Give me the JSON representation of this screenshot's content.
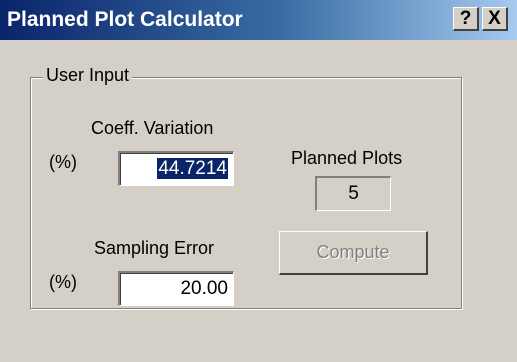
{
  "window": {
    "title": "Planned Plot Calculator",
    "help_button": "?",
    "close_button": "X"
  },
  "group": {
    "legend": "User Input"
  },
  "coeff_variation": {
    "label": "Coeff. Variation",
    "unit": "(%)",
    "value": "44.7214",
    "selected": true
  },
  "sampling_error": {
    "label": "Sampling Error",
    "unit": "(%)",
    "value": "20.00"
  },
  "planned_plots": {
    "label": "Planned Plots",
    "value": "5"
  },
  "compute": {
    "label": "Compute",
    "enabled": false
  },
  "colors": {
    "title_bar_start": "#0a246a",
    "title_bar_end": "#a6caf0",
    "dialog_face": "#d4d0c8",
    "selection": "#0a246a",
    "disabled_text": "#808080"
  }
}
